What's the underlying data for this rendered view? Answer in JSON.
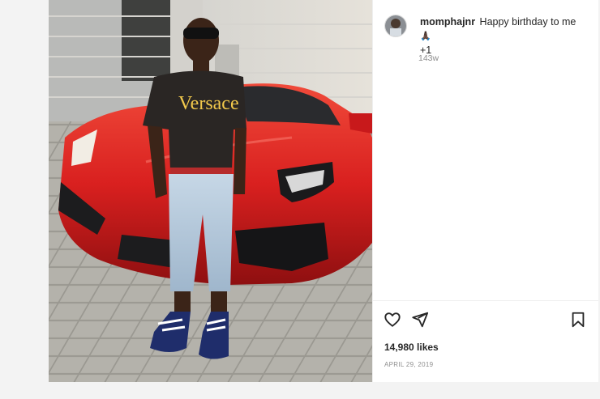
{
  "post": {
    "username": "momphajnr",
    "caption": "Happy birthday to me",
    "caption_emoji": "🙏🏿",
    "caption_suffix": "+1",
    "time_ago": "143w",
    "likes": "14,980 likes",
    "date": "APRIL 29, 2019",
    "shirt_text": "Versace"
  },
  "icons": {
    "like": "heart-icon",
    "share": "paper-plane-icon",
    "save": "bookmark-icon"
  },
  "colors": {
    "car": "#d9201f",
    "shirt": "#2a2624",
    "text": "#262626",
    "muted": "#8e8e8e"
  }
}
